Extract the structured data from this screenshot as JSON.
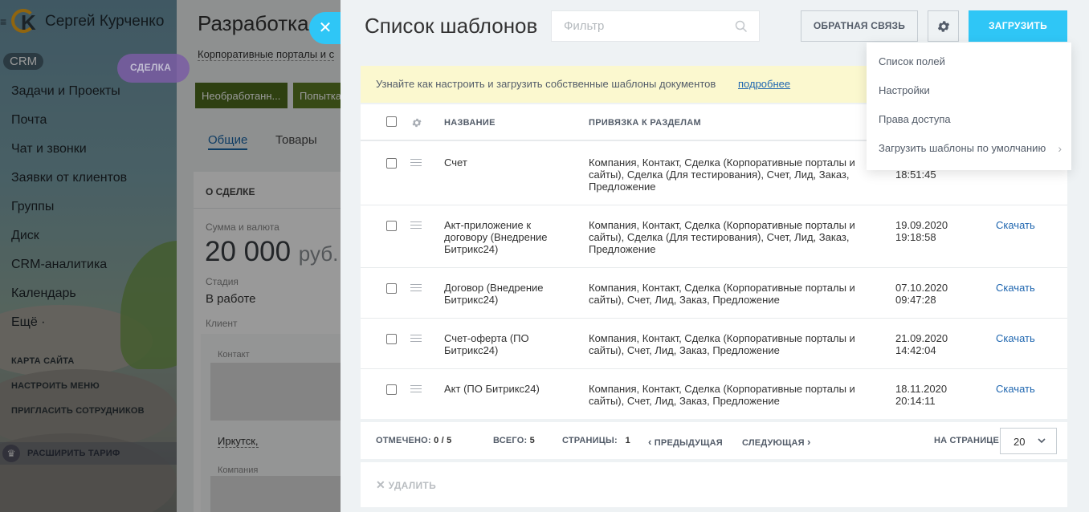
{
  "background": {
    "logo_name": "Сергей Курченко",
    "crm_badge": "CRM",
    "deal_badge": "СДЕЛКА",
    "menu_items": [
      "Задачи и Проекты",
      "Почта",
      "Чат и звонки",
      "Заявки от клиентов",
      "Группы",
      "Диск",
      "CRM-аналитика",
      "Календарь",
      "Ещё ·"
    ],
    "small_links": [
      "КАРТА САЙТА",
      "НАСТРОИТЬ МЕНЮ",
      "ПРИГЛАСИТЬ СОТРУДНИКОВ"
    ],
    "tariff": "РАСШИРИТЬ ТАРИФ",
    "deal_title": "Разработка",
    "deal_subtitle": "Корпоративные порталы и с",
    "stage_1": "Необработанн...",
    "stage_2": "Попытка",
    "tab_general": "Общие",
    "tab_goods": "Товары",
    "section_about": "О СДЕЛКЕ",
    "label_sum": "Сумма и валюта",
    "amount": "20 000",
    "currency": "руб.",
    "label_stage": "Стадия",
    "stage_value": "В работе",
    "label_client": "Клиент",
    "label_contact": "Контакт",
    "city": "Иркутск,",
    "label_company": "Компания"
  },
  "slider": {
    "title": "Список шаблонов",
    "filter_placeholder": "Фильтр",
    "feedback_button": "ОБРАТНАЯ СВЯЗЬ",
    "upload_button": "ЗАГРУЗИТЬ",
    "info_text": "Узнайте как настроить и загрузить собственные шаблоны документов",
    "info_link": "подробнее"
  },
  "table": {
    "headers": {
      "name": "НАЗВАНИЕ",
      "binding": "ПРИВЯЗКА К РАЗДЕЛАМ"
    },
    "rows": [
      {
        "name": "Счет",
        "binding": "Компания, Контакт, Сделка (Корпоративные порталы и сайты), Сделка (Для тестирования), Счет, Лид, Заказ, Предложение",
        "date": "18:51:45",
        "download": ""
      },
      {
        "name": "Акт-приложение к договору (Внедрение Битрикс24)",
        "binding": "Компания, Контакт, Сделка (Корпоративные порталы и сайты), Сделка (Для тестирования), Счет, Лид, Заказ, Предложение",
        "date": "19.09.2020 19:18:58",
        "download": "Скачать"
      },
      {
        "name": "Договор (Внедрение Битрикс24)",
        "binding": "Компания, Контакт, Сделка (Корпоративные порталы и сайты), Счет, Лид, Заказ, Предложение",
        "date": "07.10.2020 09:47:28",
        "download": "Скачать"
      },
      {
        "name": "Счет-оферта (ПО Битрикс24)",
        "binding": "Компания, Контакт, Сделка (Корпоративные порталы и сайты), Счет, Лид, Заказ, Предложение",
        "date": "21.09.2020 14:42:04",
        "download": "Скачать"
      },
      {
        "name": "Акт (ПО Битрикс24)",
        "binding": "Компания, Контакт, Сделка (Корпоративные порталы и сайты), Счет, Лид, Заказ, Предложение",
        "date": "18.11.2020 20:14:11",
        "download": "Скачать"
      }
    ]
  },
  "pager": {
    "selected_label": "ОТМЕЧЕНО:",
    "selected_value": "0 / 5",
    "total_label": "ВСЕГО:",
    "total_value": "5",
    "pages_label": "СТРАНИЦЫ:",
    "pages_value": "1",
    "prev": "ПРЕДЫДУЩАЯ",
    "next": "СЛЕДУЮЩАЯ",
    "per_page_label": "НА СТРАНИЦЕ:",
    "per_page_value": "20"
  },
  "bottom": {
    "delete": "УДАЛИТЬ"
  },
  "dropdown": {
    "items": [
      "Список полей",
      "Настройки",
      "Права доступа",
      "Загрузить шаблоны по умолчанию"
    ]
  },
  "colors": {
    "accent": "#2fc6f6",
    "link": "#2067b0",
    "info_bg": "#fbf8cf",
    "stage_green": "#4d6b1d",
    "deal_purple": "#7b5da4"
  },
  "icons": {
    "close": "close-icon",
    "search": "search-icon",
    "gear": "gear-icon",
    "drag": "drag-handle-icon",
    "chevron": "chevron-down-icon"
  }
}
